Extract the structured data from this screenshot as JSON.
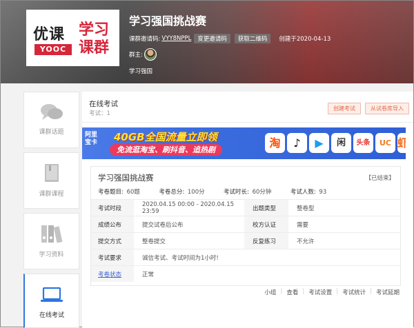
{
  "logo": {
    "part1": "优课",
    "part2": "YOOC",
    "part3": "学习",
    "part4": "课群"
  },
  "header": {
    "title": "学习强国挑战赛",
    "invite_label": "课群邀请码:",
    "invite_code": "VYY8NPPL",
    "change_code": "变更邀请码",
    "get_qr": "获取二维码",
    "created": "创建于2020-04-13",
    "owner_label": "群主:",
    "group_name": "学习强国"
  },
  "sidebar": {
    "items": [
      {
        "label": "课群话题",
        "icon": "chat-bubbles-icon"
      },
      {
        "label": "课群课程",
        "icon": "book-icon"
      },
      {
        "label": "学习资料",
        "icon": "binders-icon"
      },
      {
        "label": "在线考试",
        "icon": "laptop-icon"
      }
    ]
  },
  "main": {
    "title": "在线考试",
    "count": "考试：1",
    "create_btn": "创建考试",
    "import_btn": "从试卷库导入"
  },
  "banner": {
    "brand": "阿里\n宝卡",
    "headline": "40GB全国流量立即领",
    "subline": "免流逛淘宝、刷抖音、追热剧",
    "apps": [
      {
        "name": "taobao-icon",
        "glyph": "淘",
        "color": "#ff5000"
      },
      {
        "name": "douyin-icon",
        "glyph": "♪",
        "color": "#111111"
      },
      {
        "name": "youku-icon",
        "glyph": "▶",
        "color": "#1f9cf0"
      },
      {
        "name": "xianyu-icon",
        "glyph": "闲",
        "color": "#333333"
      },
      {
        "name": "toutiao-icon",
        "glyph": "头条",
        "color": "#e8322d"
      },
      {
        "name": "uc-icon",
        "glyph": "UC",
        "color": "#f07a20"
      },
      {
        "name": "xiami-icon",
        "glyph": "虾",
        "color": "#f96a1e"
      }
    ]
  },
  "exam": {
    "title": "学习强国挑战赛",
    "status": "【已结束】",
    "meta": {
      "questions_label": "考卷题目:",
      "questions": "60题",
      "score_label": "考卷总分:",
      "score": "100分",
      "duration_label": "考试时长:",
      "duration": "60分钟",
      "people_label": "考试人数:",
      "people": "93"
    },
    "rows": {
      "time_label": "考试时段",
      "time": "2020.04.15 00:00 - 2020.04.15 23:59",
      "type_label": "出题类型",
      "type": "整卷型",
      "publish_label": "成绩公布",
      "publish": "提交试卷后公布",
      "verify_label": "校方认证",
      "verify": "需要",
      "submit_label": "提交方式",
      "submit": "整卷提交",
      "practice_label": "反复练习",
      "practice": "不允许",
      "req_label": "考试要求",
      "req": "诚信考试、考试时间为1小时!",
      "state_label": "考卷状态",
      "state": "正常"
    },
    "actions": [
      "小组",
      "查看",
      "考试设置",
      "考试统计",
      "考试延期"
    ]
  }
}
